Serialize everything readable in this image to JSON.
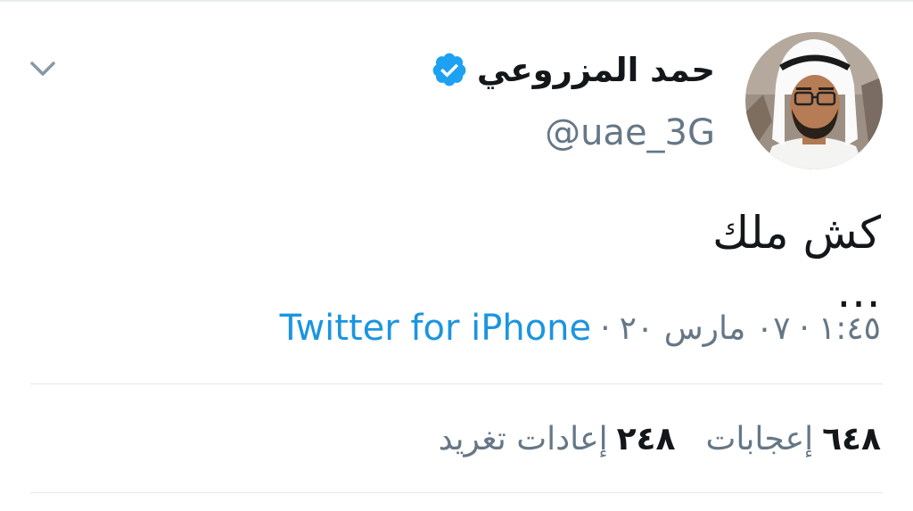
{
  "author": {
    "display_name": "حمد المزروعي",
    "handle": "@uae_3G",
    "verified": true,
    "avatar_icon": "profile-photo"
  },
  "tweet": {
    "text": "كش ملك\n…",
    "time": "١:٤٥",
    "date": "٠٧ مارس ٢٠",
    "separator": "·",
    "source": "Twitter for iPhone"
  },
  "stats": {
    "retweets": {
      "count": "٢٤٨",
      "label": "إعادات تغريد"
    },
    "likes": {
      "count": "٦٤٨",
      "label": "إعجابات"
    }
  },
  "icons": {
    "menu": "chevron-down-icon",
    "verified": "verified-badge-icon"
  },
  "colors": {
    "link": "#1b95e0",
    "verified": "#1da1f2",
    "text": "#14171a",
    "secondary": "#657786",
    "divider": "#e1e8ed"
  }
}
